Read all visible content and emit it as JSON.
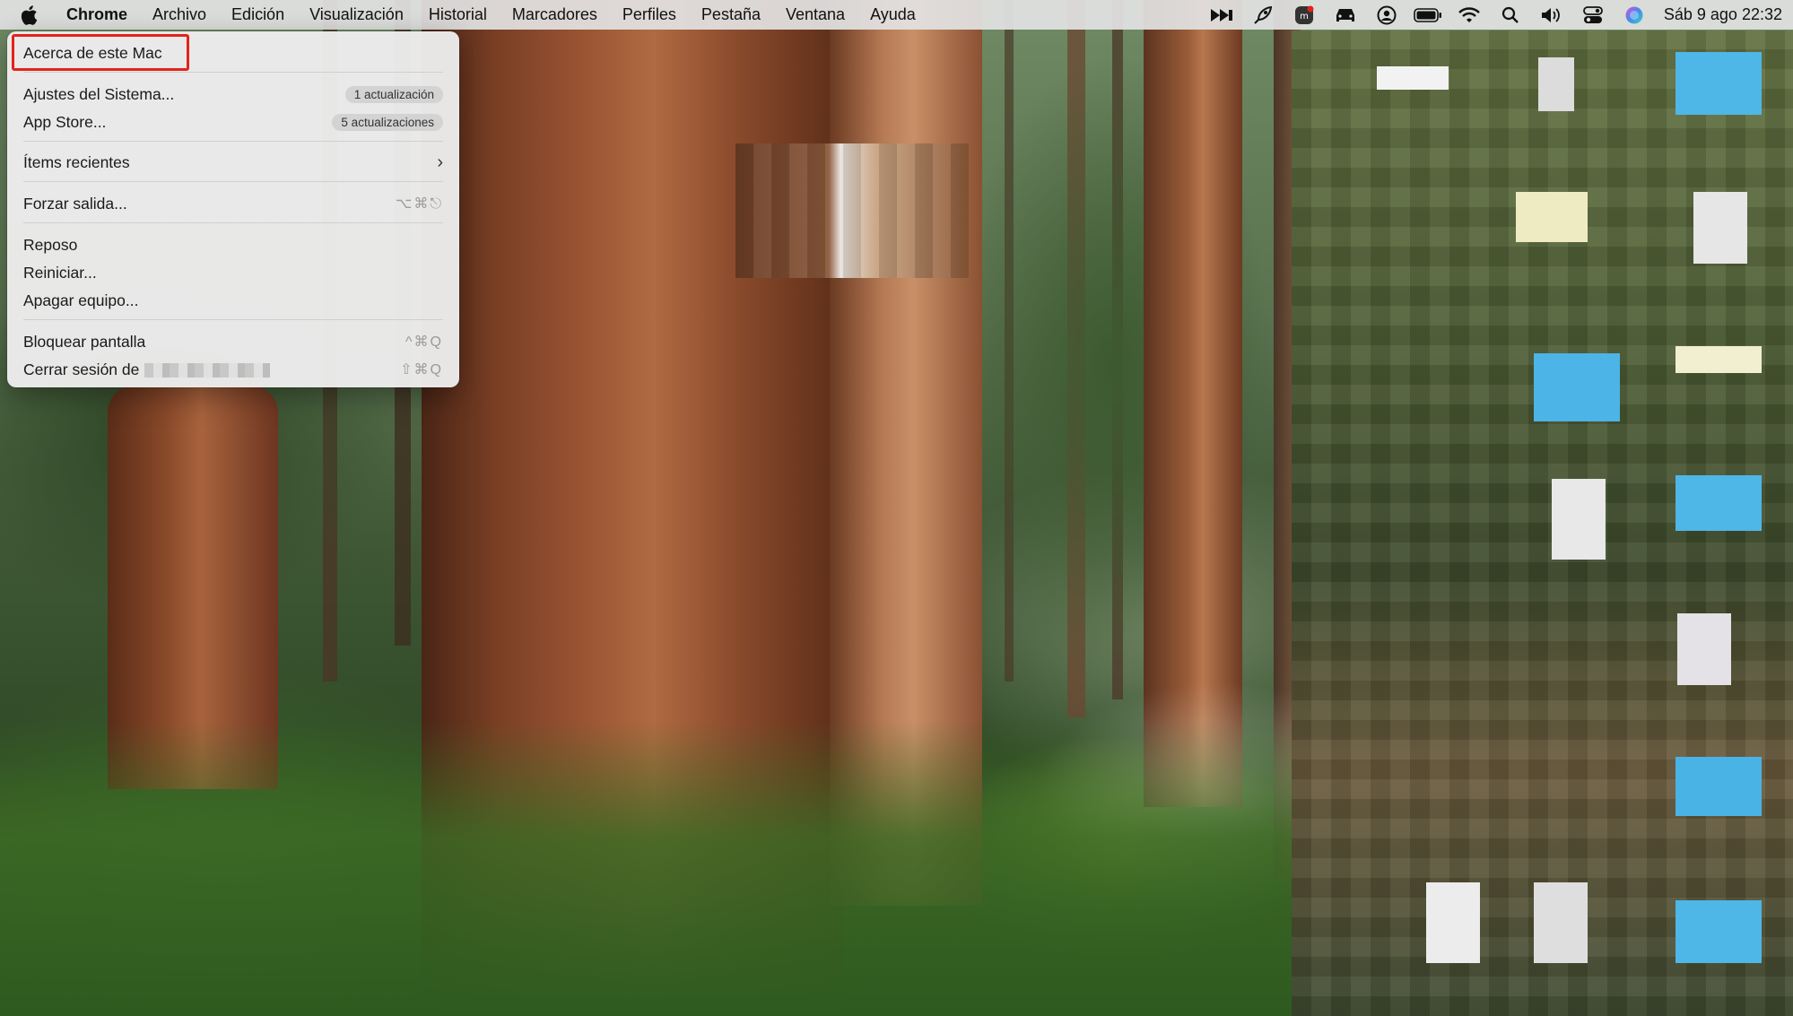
{
  "menubar": {
    "apple_icon": "apple-icon",
    "app_name": "Chrome",
    "menus": [
      "Archivo",
      "Edición",
      "Visualización",
      "Historial",
      "Marcadores",
      "Perfiles",
      "Pestaña",
      "Ventana",
      "Ayuda"
    ],
    "status_icons": [
      "forward-arrows-icon",
      "rocket-icon",
      "app-badge-icon",
      "car-icon",
      "user-circle-icon",
      "battery-icon",
      "wifi-icon",
      "search-icon",
      "volume-icon",
      "control-center-icon",
      "siri-icon"
    ],
    "clock": "Sáb 9 ago 22:32"
  },
  "apple_menu": {
    "about": "Acerca de este Mac",
    "system_settings": {
      "label": "Ajustes del Sistema...",
      "badge": "1 actualización"
    },
    "app_store": {
      "label": "App Store...",
      "badge": "5 actualizaciones"
    },
    "recent_items": "Ítems recientes",
    "force_quit": {
      "label": "Forzar salida...",
      "shortcut": "⌥⌘⎋"
    },
    "sleep": "Reposo",
    "restart": "Reiniciar...",
    "shutdown": "Apagar equipo...",
    "lock_screen": {
      "label": "Bloquear pantalla",
      "shortcut": "^⌘Q"
    },
    "log_out": {
      "label": "Cerrar sesión de",
      "shortcut": "⇧⌘Q"
    }
  },
  "colors": {
    "highlight": "#e3231a",
    "menubar_bg": "#e2e2e2",
    "menu_bg": "#ececec"
  }
}
